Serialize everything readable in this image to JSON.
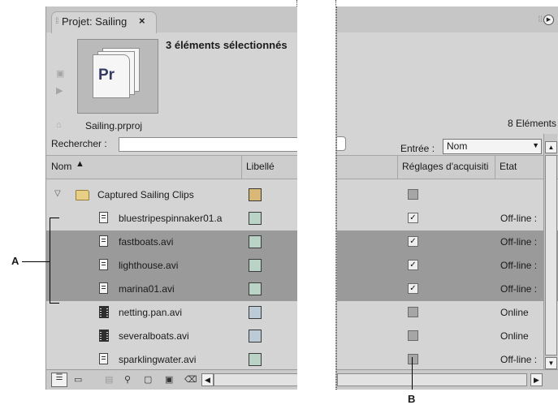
{
  "tab": {
    "title": "Projet: Sailing",
    "close": "×"
  },
  "preview": {
    "thumb_text": "Pr",
    "selection_info": "3 éléments sélectionnés"
  },
  "project": {
    "file": "Sailing.prproj",
    "item_count": "8 Eléments"
  },
  "search": {
    "label": "Rechercher :",
    "value": "",
    "entry_label": "Entrée :",
    "entry_value": "Nom"
  },
  "columns": {
    "name": "Nom",
    "label": "Libellé",
    "capture": "Réglages d'acquisiti",
    "status": "Etat"
  },
  "rows": [
    {
      "name": "Captured Sailing Clips",
      "type": "folder",
      "color": "#d9b774",
      "capture": "",
      "status": "",
      "selected": false
    },
    {
      "name": "bluestripespinnaker01.a",
      "type": "script",
      "color": "#b9d4c7",
      "capture": "✓",
      "status": "Off-line :",
      "selected": false
    },
    {
      "name": "fastboats.avi",
      "type": "script",
      "color": "#b9d4c7",
      "capture": "✓",
      "status": "Off-line :",
      "selected": true
    },
    {
      "name": "lighthouse.avi",
      "type": "script",
      "color": "#b9d4c7",
      "capture": "✓",
      "status": "Off-line :",
      "selected": true
    },
    {
      "name": "marina01.avi",
      "type": "script",
      "color": "#b9d4c7",
      "capture": "✓",
      "status": "Off-line :",
      "selected": true
    },
    {
      "name": "netting.pan.avi",
      "type": "film",
      "color": "#bccbd8",
      "capture": "",
      "status": "Online",
      "selected": false
    },
    {
      "name": "severalboats.avi",
      "type": "film",
      "color": "#bccbd8",
      "capture": "",
      "status": "Online",
      "selected": false
    },
    {
      "name": "sparklingwater.avi",
      "type": "script",
      "color": "#b9d4c7",
      "capture": "",
      "status": "Off-line :",
      "selected": false
    }
  ],
  "callouts": {
    "a": "A",
    "b": "B"
  },
  "icons": {
    "tab_grip": "grip-icon",
    "close": "close-icon",
    "play": "play-icon",
    "folder_up": "folder-up-icon",
    "sort": "sort-ascending-icon",
    "expand": "disclosure-triangle-icon",
    "list_view": "list-view-icon",
    "icon_view": "icon-view-icon",
    "find": "binoculars-icon",
    "new_bin": "new-bin-icon",
    "new_item": "new-item-icon",
    "clear": "trash-icon",
    "panel_menu": "panel-menu-icon"
  },
  "colors": {
    "panel_bg": "#d4d4d4",
    "selected_row": "#9a9a9a",
    "folder_label": "#d9b774",
    "clip_label": "#b9d4c7",
    "video_label": "#bccbd8"
  }
}
